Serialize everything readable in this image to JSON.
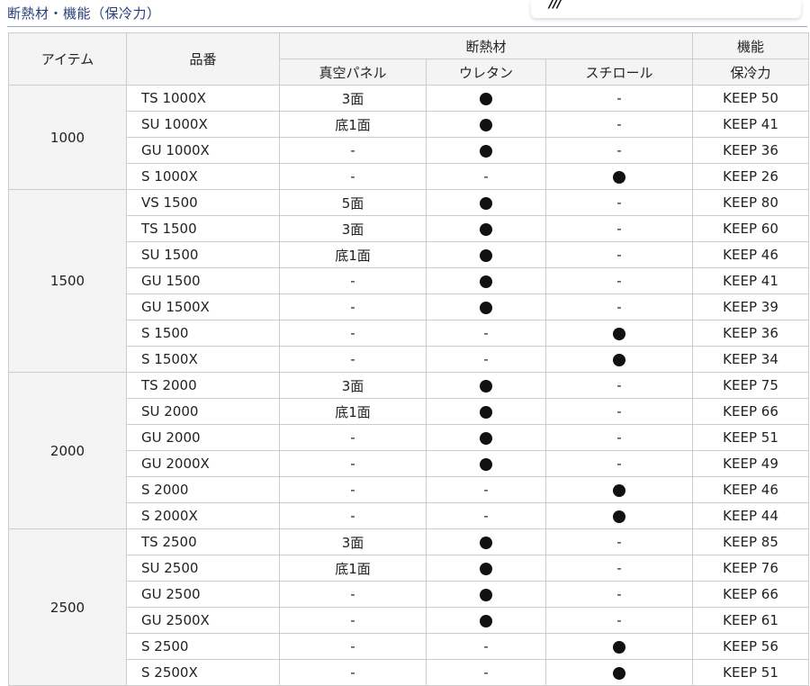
{
  "section_title": "断熱材・機能（保冷力）",
  "logo_text": "///",
  "headers": {
    "item": "アイテム",
    "model": "品番",
    "insulation": "断熱材",
    "function": "機能",
    "vacuum_panel": "真空パネル",
    "urethane": "ウレタン",
    "styrofoam": "スチロール",
    "cold_retention": "保冷力"
  },
  "marks": {
    "dot": "●",
    "dash": "-"
  },
  "groups": [
    {
      "item": "1000",
      "rows": [
        {
          "model": "TS 1000X",
          "vacuum": "3面",
          "urethane": "●",
          "styro": "-",
          "keep": "KEEP 50"
        },
        {
          "model": "SU 1000X",
          "vacuum": "底1面",
          "urethane": "●",
          "styro": "-",
          "keep": "KEEP 41"
        },
        {
          "model": "GU 1000X",
          "vacuum": "-",
          "urethane": "●",
          "styro": "-",
          "keep": "KEEP 36"
        },
        {
          "model": "S 1000X",
          "vacuum": "-",
          "urethane": "-",
          "styro": "●",
          "keep": "KEEP 26"
        }
      ]
    },
    {
      "item": "1500",
      "rows": [
        {
          "model": "VS 1500",
          "vacuum": "5面",
          "urethane": "●",
          "styro": "-",
          "keep": "KEEP 80"
        },
        {
          "model": "TS 1500",
          "vacuum": "3面",
          "urethane": "●",
          "styro": "-",
          "keep": "KEEP 60"
        },
        {
          "model": "SU 1500",
          "vacuum": "底1面",
          "urethane": "●",
          "styro": "-",
          "keep": "KEEP 46"
        },
        {
          "model": "GU 1500",
          "vacuum": "-",
          "urethane": "●",
          "styro": "-",
          "keep": "KEEP 41"
        },
        {
          "model": "GU 1500X",
          "vacuum": "-",
          "urethane": "●",
          "styro": "-",
          "keep": "KEEP 39"
        },
        {
          "model": "S 1500",
          "vacuum": "-",
          "urethane": "-",
          "styro": "●",
          "keep": "KEEP 36"
        },
        {
          "model": "S 1500X",
          "vacuum": "-",
          "urethane": "-",
          "styro": "●",
          "keep": "KEEP 34"
        }
      ]
    },
    {
      "item": "2000",
      "rows": [
        {
          "model": "TS 2000",
          "vacuum": "3面",
          "urethane": "●",
          "styro": "-",
          "keep": "KEEP 75"
        },
        {
          "model": "SU 2000",
          "vacuum": "底1面",
          "urethane": "●",
          "styro": "-",
          "keep": "KEEP 66"
        },
        {
          "model": "GU 2000",
          "vacuum": "-",
          "urethane": "●",
          "styro": "-",
          "keep": "KEEP 51"
        },
        {
          "model": "GU 2000X",
          "vacuum": "-",
          "urethane": "●",
          "styro": "-",
          "keep": "KEEP 49"
        },
        {
          "model": "S 2000",
          "vacuum": "-",
          "urethane": "-",
          "styro": "●",
          "keep": "KEEP 46"
        },
        {
          "model": "S 2000X",
          "vacuum": "-",
          "urethane": "-",
          "styro": "●",
          "keep": "KEEP 44"
        }
      ]
    },
    {
      "item": "2500",
      "rows": [
        {
          "model": "TS 2500",
          "vacuum": "3面",
          "urethane": "●",
          "styro": "-",
          "keep": "KEEP 85"
        },
        {
          "model": "SU 2500",
          "vacuum": "底1面",
          "urethane": "●",
          "styro": "-",
          "keep": "KEEP 76"
        },
        {
          "model": "GU 2500",
          "vacuum": "-",
          "urethane": "●",
          "styro": "-",
          "keep": "KEEP 66"
        },
        {
          "model": "GU 2500X",
          "vacuum": "-",
          "urethane": "●",
          "styro": "-",
          "keep": "KEEP 61"
        },
        {
          "model": "S 2500",
          "vacuum": "-",
          "urethane": "-",
          "styro": "●",
          "keep": "KEEP 56"
        },
        {
          "model": "S 2500X",
          "vacuum": "-",
          "urethane": "-",
          "styro": "●",
          "keep": "KEEP 51"
        }
      ]
    }
  ]
}
